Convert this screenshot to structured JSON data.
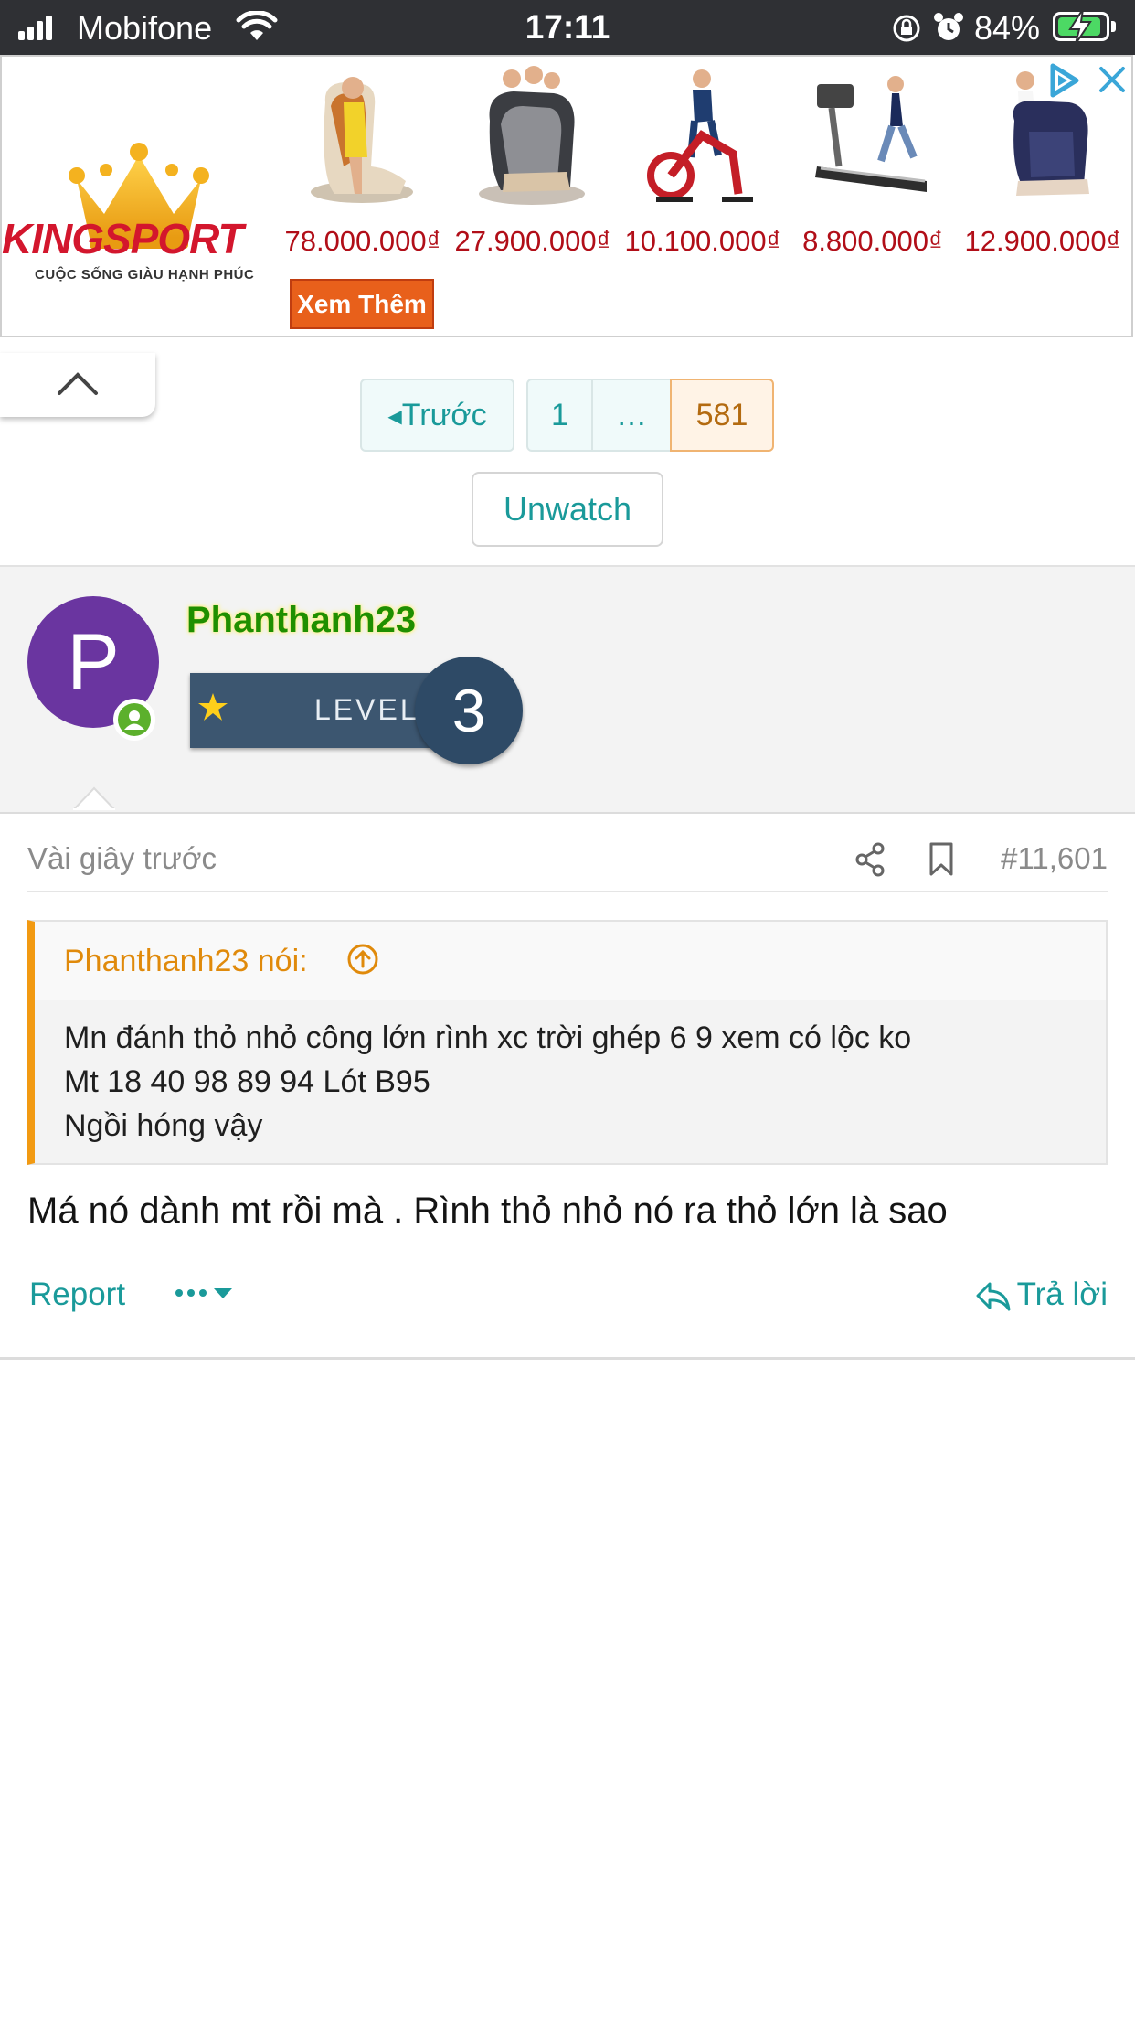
{
  "status_bar": {
    "carrier": "Mobifone",
    "time": "17:11",
    "battery": "84%"
  },
  "ad": {
    "brand": "KINGSPORT",
    "slogan": "CUỘC SỐNG GIÀU HẠNH PHÚC",
    "products": [
      {
        "price": "78.000.000₫",
        "icon": "massage-chair-icon"
      },
      {
        "price": "27.900.000₫",
        "icon": "massage-chair-icon"
      },
      {
        "price": "10.100.000₫",
        "icon": "exercise-bike-icon"
      },
      {
        "price": "8.800.000₫",
        "icon": "treadmill-icon"
      },
      {
        "price": "12.900.000₫",
        "icon": "massage-chair-icon"
      }
    ],
    "cta": "Xem Thêm"
  },
  "pagination": {
    "prev": "Trước",
    "first": "1",
    "dots": "…",
    "last": "581"
  },
  "unwatch_label": "Unwatch",
  "post": {
    "avatar_letter": "P",
    "username": "Phanthanh23",
    "level_label": "LEVEL",
    "level": "3",
    "time": "Vài giây trước",
    "number": "#11,601",
    "quote": {
      "author": "Phanthanh23 nói:",
      "lines": [
        "Mn đánh thỏ nhỏ công lớn rình xc trời ghép 6 9 xem có lộc ko",
        "Mt 18 40 98 89 94 Lót B95",
        "Ngồi hóng vậy"
      ]
    },
    "text": "Má nó dành mt rồi mà . Rình thỏ nhỏ nó ra thỏ lớn là sao",
    "report": "Report",
    "reply": "Trả lời"
  },
  "colors": {
    "accent": "#1a9a9a",
    "quote_border": "#f29a12",
    "price": "#b10e18",
    "avatar": "#6a35a0"
  }
}
